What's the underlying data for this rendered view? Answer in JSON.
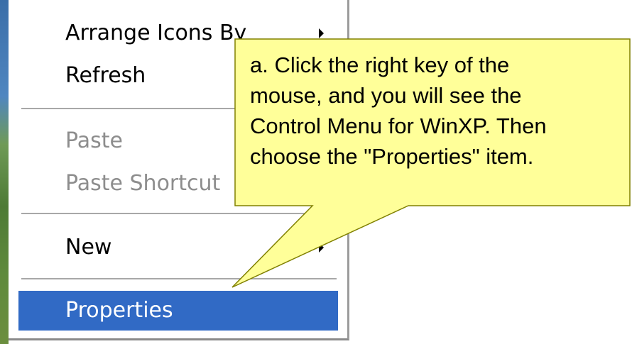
{
  "context_menu": {
    "items": [
      {
        "label": "Arrange Icons By",
        "state": "enabled",
        "has_submenu": true
      },
      {
        "label": "Refresh",
        "state": "enabled",
        "has_submenu": false
      },
      {
        "label": "Paste",
        "state": "disabled",
        "has_submenu": false
      },
      {
        "label": "Paste Shortcut",
        "state": "disabled",
        "has_submenu": false
      },
      {
        "label": "New",
        "state": "enabled",
        "has_submenu": true
      },
      {
        "label": "Properties",
        "state": "selected",
        "has_submenu": false
      }
    ],
    "selection_color": "#316ac5"
  },
  "callout": {
    "lines": [
      "a. Click the right key of the",
      "mouse, and you will see the",
      "Control Menu for WinXP. Then",
      "choose the \"Properties\" item."
    ],
    "fill_color": "#ffff99",
    "border_color": "#808000"
  }
}
